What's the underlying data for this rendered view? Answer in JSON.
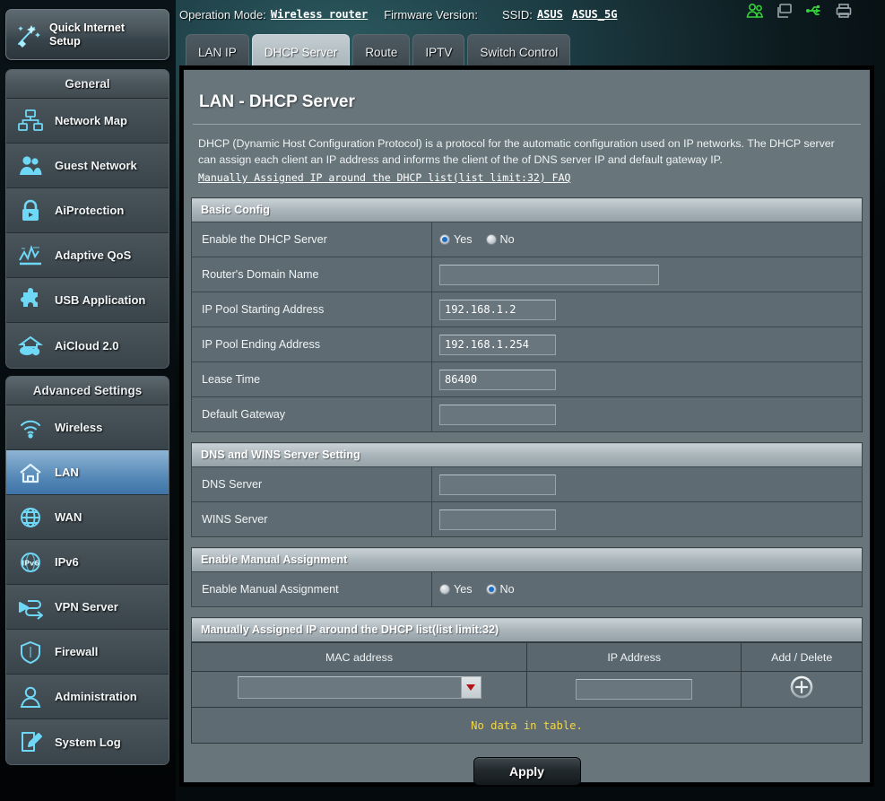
{
  "quick_setup": {
    "label_line1": "Quick Internet",
    "label_line2": "Setup",
    "icon": "magic-wand-icon"
  },
  "topbar": {
    "operation_mode_label": "Operation Mode:",
    "operation_mode_value": "Wireless router",
    "firmware_label": "Firmware Version:",
    "firmware_value": "",
    "ssid_label": "SSID:",
    "ssid_value_1": "ASUS",
    "ssid_value_2": "ASUS_5G",
    "icons": [
      "guest-users-icon",
      "network-clients-icon",
      "usb-icon",
      "printer-icon"
    ],
    "icon_accent": "#34d13a",
    "icon_muted": "#9aa6ab"
  },
  "sidebar": {
    "general": {
      "title": "General",
      "items": [
        {
          "label": "Network Map",
          "icon": "network-map-icon"
        },
        {
          "label": "Guest Network",
          "icon": "guest-network-icon"
        },
        {
          "label": "AiProtection",
          "icon": "lock-shield-icon"
        },
        {
          "label": "Adaptive QoS",
          "icon": "chart-qos-icon"
        },
        {
          "label": "USB Application",
          "icon": "puzzle-icon"
        },
        {
          "label": "AiCloud 2.0",
          "icon": "cloud-home-icon"
        }
      ]
    },
    "advanced": {
      "title": "Advanced Settings",
      "items": [
        {
          "label": "Wireless",
          "icon": "wifi-icon",
          "active": false
        },
        {
          "label": "LAN",
          "icon": "home-icon",
          "active": true
        },
        {
          "label": "WAN",
          "icon": "globe-icon",
          "active": false
        },
        {
          "label": "IPv6",
          "icon": "ipv6-globe-icon",
          "active": false
        },
        {
          "label": "VPN Server",
          "icon": "vpn-key-icon",
          "active": false
        },
        {
          "label": "Firewall",
          "icon": "shield-icon",
          "active": false
        },
        {
          "label": "Administration",
          "icon": "user-icon",
          "active": false
        },
        {
          "label": "System Log",
          "icon": "log-pencil-icon",
          "active": false
        }
      ]
    }
  },
  "tabs": [
    {
      "label": "LAN IP",
      "active": false
    },
    {
      "label": "DHCP Server",
      "active": true
    },
    {
      "label": "Route",
      "active": false
    },
    {
      "label": "IPTV",
      "active": false
    },
    {
      "label": "Switch Control",
      "active": false
    }
  ],
  "main": {
    "page_title": "LAN - DHCP Server",
    "description_line1": "DHCP (Dynamic Host Configuration Protocol) is a protocol for the automatic configuration used on IP networks. The DHCP server",
    "description_line2": "can assign each client an IP address and informs the client of the of DNS server IP and default gateway IP.",
    "faq_link": "Manually Assigned IP around the DHCP list(list limit:32) FAQ",
    "basic_config": {
      "header": "Basic Config",
      "enable_dhcp": {
        "label": "Enable the DHCP Server",
        "yes_label": "Yes",
        "no_label": "No",
        "selected": "Yes"
      },
      "domain_name": {
        "label": "Router's Domain Name",
        "value": "",
        "placeholder": ""
      },
      "pool_start": {
        "label": "IP Pool Starting Address",
        "value": "192.168.1.2"
      },
      "pool_end": {
        "label": "IP Pool Ending Address",
        "value": "192.168.1.254"
      },
      "lease_time": {
        "label": "Lease Time",
        "value": "86400"
      },
      "default_gw": {
        "label": "Default Gateway",
        "value": ""
      }
    },
    "dns_wins": {
      "header": "DNS and WINS Server Setting",
      "dns_server": {
        "label": "DNS Server",
        "value": ""
      },
      "wins_server": {
        "label": "WINS Server",
        "value": ""
      }
    },
    "manual_assignment": {
      "header": "Enable Manual Assignment",
      "enable": {
        "label": "Enable Manual Assignment",
        "yes_label": "Yes",
        "no_label": "No",
        "selected": "No"
      }
    },
    "assigned_list": {
      "header": "Manually Assigned IP around the DHCP list(list limit:32)",
      "columns": [
        "MAC address",
        "IP Address",
        "Add / Delete"
      ],
      "entry_row": {
        "mac_value": "",
        "ip_value": "",
        "add_icon": "plus-circle-icon"
      },
      "empty_message": "No data in table.",
      "empty_message_color": "#f2d64a"
    },
    "apply_button": "Apply"
  }
}
